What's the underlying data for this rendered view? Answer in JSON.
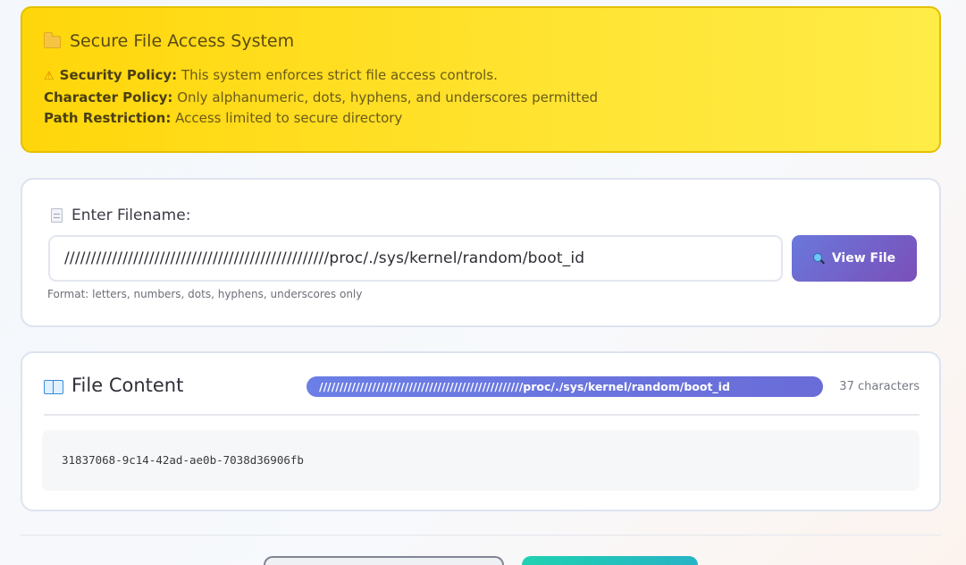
{
  "banner": {
    "title": "Secure File Access System",
    "title_icon": "folder-icon",
    "security_label": "Security Policy:",
    "security_text": " This system enforces strict file access controls.",
    "security_icon": "warning-icon",
    "character_label": "Character Policy:",
    "character_text": " Only alphanumeric, dots, hyphens, and underscores permitted",
    "path_label": "Path Restriction:",
    "path_text": " Access limited to secure directory",
    "colors": {
      "background": "#ffd60a",
      "border": "#e4c000"
    }
  },
  "input_card": {
    "label": "Enter Filename:",
    "label_icon": "document-icon",
    "input_value": "//////////////////////////////////////////////////proc/./sys/kernel/random/boot_id",
    "button_label": "View File",
    "button_icon": "magnifier-icon",
    "hint": "Format: letters, numbers, dots, hyphens, underscores only"
  },
  "content_card": {
    "title": "File Content",
    "title_icon": "open-book-icon",
    "path_badge": "//////////////////////////////////////////////////proc/./sys/kernel/random/boot_id",
    "char_count": "37 characters",
    "content": "31837068-9c14-42ad-ae0b-7038d36906fb",
    "colors": {
      "badge": "#6b7fe6",
      "content_bg": "#f6f7f9"
    }
  },
  "footer": {
    "colors": {
      "left_button_border": "#7f8592",
      "right_button": "#1fd2b0"
    }
  }
}
